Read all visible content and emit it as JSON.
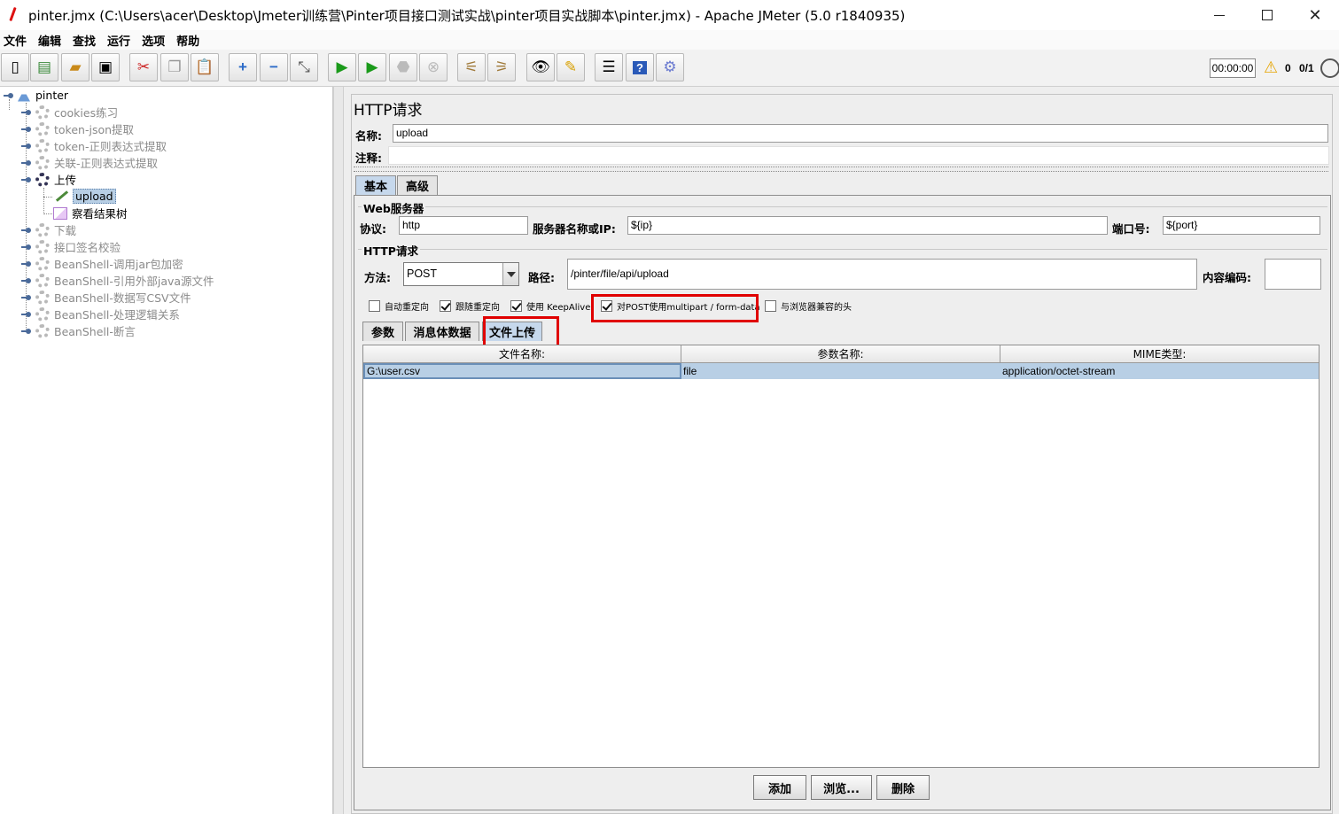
{
  "window": {
    "title": "pinter.jmx (C:\\Users\\acer\\Desktop\\Jmeter训练营\\Pinter项目接口测试实战\\pinter项目实战脚本\\pinter.jmx) - Apache JMeter (5.0 r1840935)"
  },
  "menu": [
    "文件",
    "编辑",
    "查找",
    "运行",
    "选项",
    "帮助"
  ],
  "toolbar": {
    "buttons": [
      "new-icon",
      "templates-icon",
      "open-icon",
      "save-icon",
      "cut-icon",
      "copy-icon",
      "paste-icon",
      "expand-icon",
      "collapse-icon",
      "toggle-icon",
      "start-icon",
      "start-no-pause-icon",
      "stop-icon",
      "shutdown-icon",
      "clear-icon",
      "clear-all-icon",
      "search-icon",
      "reset-search-icon",
      "function-helper-icon",
      "help-icon",
      "remote-icon"
    ],
    "timer": "00:00:00",
    "warning_count": "0",
    "threads": "0/1"
  },
  "tree": {
    "root": "pinter",
    "items": [
      {
        "label": "cookies练习",
        "enabled": false
      },
      {
        "label": "token-json提取",
        "enabled": false
      },
      {
        "label": "token-正则表达式提取",
        "enabled": false
      },
      {
        "label": "关联-正则表达式提取",
        "enabled": false
      },
      {
        "label": "上传",
        "enabled": true
      },
      {
        "label": "upload",
        "enabled": true
      },
      {
        "label": "察看结果树",
        "enabled": true
      },
      {
        "label": "下载",
        "enabled": false
      },
      {
        "label": "接口签名校验",
        "enabled": false
      },
      {
        "label": "BeanShell-调用jar包加密",
        "enabled": false
      },
      {
        "label": "BeanShell-引用外部java源文件",
        "enabled": false
      },
      {
        "label": "BeanShell-数据写CSV文件",
        "enabled": false
      },
      {
        "label": "BeanShell-处理逻辑关系",
        "enabled": false
      },
      {
        "label": "BeanShell-断言",
        "enabled": false
      }
    ]
  },
  "sampler": {
    "title": "HTTP请求",
    "name_label": "名称:",
    "name_value": "upload",
    "comment_label": "注释:",
    "comment_value": "",
    "tabs": [
      "基本",
      "高级"
    ],
    "web_server_group": "Web服务器",
    "protocol_label": "协议:",
    "protocol_value": "http",
    "server_label": "服务器名称或IP:",
    "server_value": "${ip}",
    "port_label": "端口号:",
    "port_value": "${port}",
    "http_group": "HTTP请求",
    "method_label": "方法:",
    "method_value": "POST",
    "path_label": "路径:",
    "path_value": "/pinter/file/api/upload",
    "encoding_label": "内容编码:",
    "encoding_value": "",
    "checkboxes": [
      {
        "label": "自动重定向",
        "checked": false
      },
      {
        "label": "跟随重定向",
        "checked": true
      },
      {
        "label": "使用 KeepAlive",
        "checked": true
      },
      {
        "label": "对POST使用multipart / form-data",
        "checked": true
      },
      {
        "label": "与浏览器兼容的头",
        "checked": false
      }
    ],
    "sub_tabs": [
      "参数",
      "消息体数据",
      "文件上传"
    ],
    "file_table": {
      "headers": [
        "文件名称:",
        "参数名称:",
        "MIME类型:"
      ],
      "rows": [
        [
          "G:\\user.csv",
          "file",
          "application/octet-stream"
        ]
      ]
    },
    "buttons": {
      "add": "添加",
      "browse": "浏览...",
      "delete": "删除"
    }
  },
  "colors": {
    "highlight": "#e00000",
    "selection": "#b8cfe5"
  }
}
